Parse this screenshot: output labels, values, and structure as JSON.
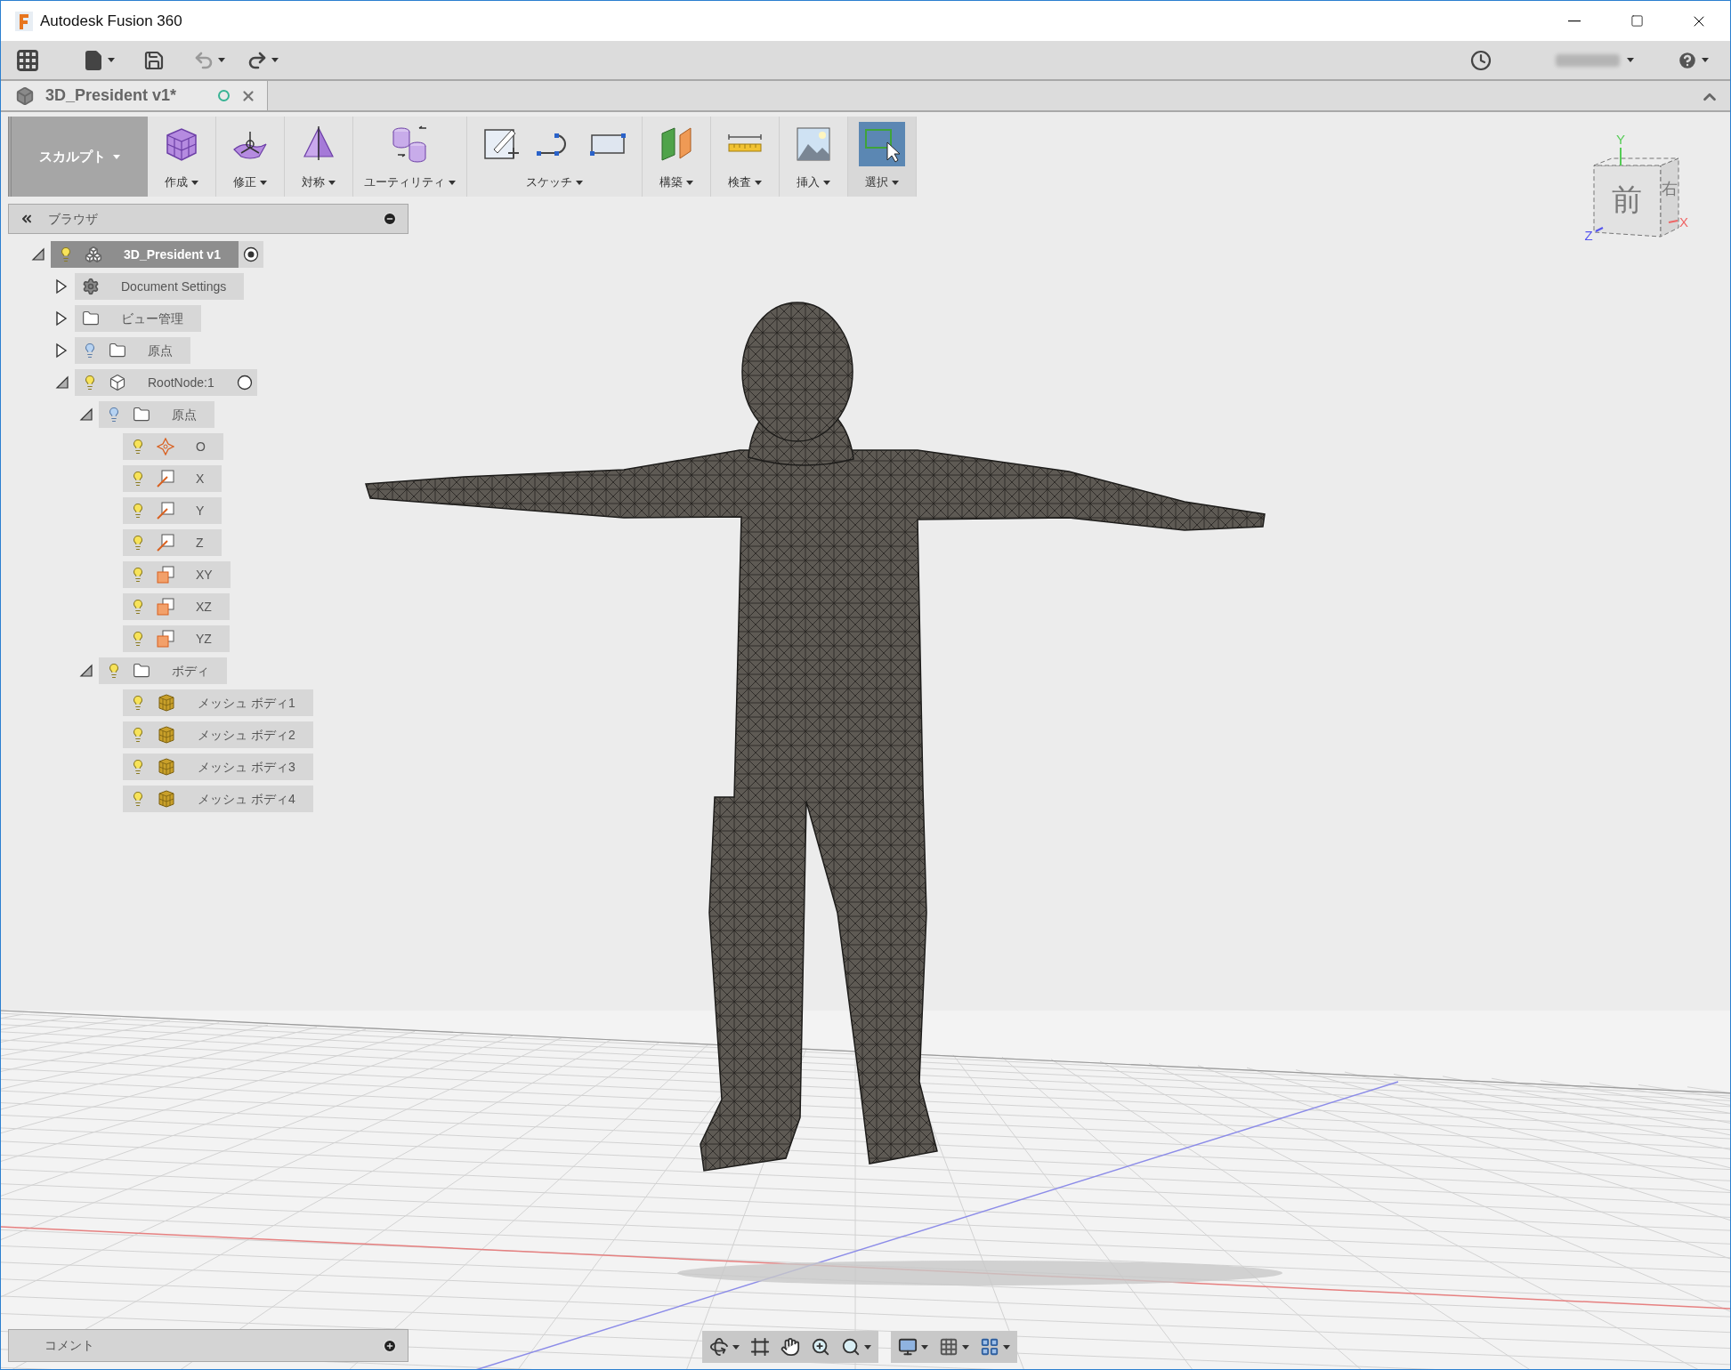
{
  "window": {
    "title": "Autodesk Fusion 360"
  },
  "document_tab": {
    "title": "3D_President v1*"
  },
  "toolbar": {
    "workspace": "スカルプト",
    "groups": [
      {
        "label": "作成",
        "kind": "create",
        "selected": false
      },
      {
        "label": "修正",
        "kind": "modify",
        "selected": false
      },
      {
        "label": "対称",
        "kind": "symmetry",
        "selected": false
      },
      {
        "label": "ユーティリティ",
        "kind": "utility",
        "selected": false
      },
      {
        "label": "スケッチ",
        "kind": "sketch",
        "selected": false
      },
      {
        "label": "構築",
        "kind": "construct",
        "selected": false
      },
      {
        "label": "検査",
        "kind": "inspect",
        "selected": false
      },
      {
        "label": "挿入",
        "kind": "insert",
        "selected": false
      },
      {
        "label": "選択",
        "kind": "select",
        "selected": true
      }
    ]
  },
  "browser": {
    "title": "ブラウザ",
    "tree": [
      {
        "label": "3D_President v1",
        "kind": "document",
        "selected": true,
        "visible": true,
        "expanded": true,
        "active": true,
        "children": [
          {
            "label": "Document Settings",
            "kind": "settings",
            "selected": false,
            "expanded": false
          },
          {
            "label": "ビュー管理",
            "kind": "folder",
            "selected": false,
            "expanded": false
          },
          {
            "label": "原点",
            "kind": "folder",
            "selected": false,
            "visible": false,
            "expanded": false
          },
          {
            "label": "RootNode:1",
            "kind": "component",
            "selected": false,
            "visible": true,
            "expanded": true,
            "active": false,
            "children": [
              {
                "label": "原点",
                "kind": "folder",
                "selected": false,
                "visible": false,
                "expanded": true,
                "children": [
                  {
                    "label": "O",
                    "kind": "point",
                    "selected": false,
                    "visible": true
                  },
                  {
                    "label": "X",
                    "kind": "axis",
                    "selected": false,
                    "visible": true
                  },
                  {
                    "label": "Y",
                    "kind": "axis",
                    "selected": false,
                    "visible": true
                  },
                  {
                    "label": "Z",
                    "kind": "axis",
                    "selected": false,
                    "visible": true
                  },
                  {
                    "label": "XY",
                    "kind": "plane",
                    "selected": false,
                    "visible": true
                  },
                  {
                    "label": "XZ",
                    "kind": "plane",
                    "selected": false,
                    "visible": true
                  },
                  {
                    "label": "YZ",
                    "kind": "plane",
                    "selected": false,
                    "visible": true
                  }
                ]
              },
              {
                "label": "ボディ",
                "kind": "folder",
                "selected": false,
                "visible": true,
                "expanded": true,
                "children": [
                  {
                    "label": "メッシュ ボディ1",
                    "kind": "mesh",
                    "selected": false,
                    "visible": true
                  },
                  {
                    "label": "メッシュ ボディ2",
                    "kind": "mesh",
                    "selected": false,
                    "visible": true
                  },
                  {
                    "label": "メッシュ ボディ3",
                    "kind": "mesh",
                    "selected": false,
                    "visible": true
                  },
                  {
                    "label": "メッシュ ボディ4",
                    "kind": "mesh",
                    "selected": false,
                    "visible": true
                  }
                ]
              }
            ]
          }
        ]
      }
    ]
  },
  "view_cube": {
    "front": "前",
    "right": "右",
    "axis_x": "X",
    "axis_y": "Y",
    "axis_z": "Z"
  },
  "comments": {
    "title": "コメント"
  }
}
